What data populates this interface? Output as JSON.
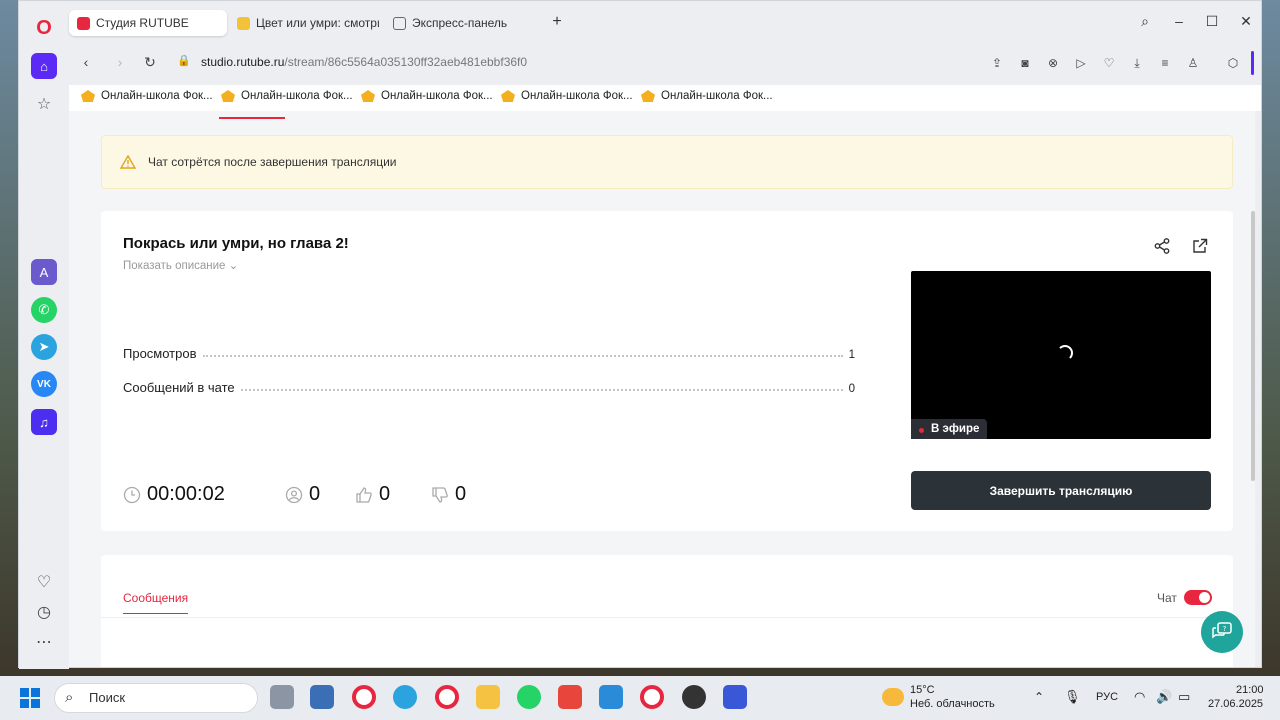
{
  "browser": {
    "tabs": [
      {
        "label": "Студия RUTUBE",
        "active": true
      },
      {
        "label": "Цвет или умри: смотрите",
        "active": false
      },
      {
        "label": "Экспресс-панель",
        "active": false
      }
    ],
    "url_domain": "studio.rutube.ru",
    "url_path": "/stream/86c5564a035130ff32aeb481ebbf36f0",
    "bookmarks": [
      "Онлайн-школа Фок...",
      "Онлайн-школа Фок...",
      "Онлайн-школа Фок...",
      "Онлайн-школа Фок...",
      "Онлайн-школа Фок..."
    ]
  },
  "notice": {
    "text": "Чат сотрётся после завершения трансляции"
  },
  "stream": {
    "title": "Покрась или умри, но глава 2!",
    "show_description": "Показать описание",
    "stats": [
      {
        "label": "Просмотров",
        "value": "1"
      },
      {
        "label": "Сообщений в чате",
        "value": "0"
      }
    ],
    "duration": "00:00:02",
    "viewers": "0",
    "likes": "0",
    "dislikes": "0",
    "live_badge": "В эфире",
    "end_button": "Завершить трансляцию"
  },
  "chat": {
    "tab_label": "Сообщения",
    "toggle_label": "Чат",
    "enabled": true
  },
  "taskbar": {
    "search_placeholder": "Поиск",
    "weather_temp": "15°C",
    "weather_desc": "Неб. облачность",
    "lang": "РУС",
    "time": "21:00",
    "date": "27.06.2025"
  },
  "colors": {
    "accent": "#e8263f",
    "button_dark": "#2b3238",
    "notice_bg": "#fdf8e3",
    "help_fab": "#20a59c"
  }
}
